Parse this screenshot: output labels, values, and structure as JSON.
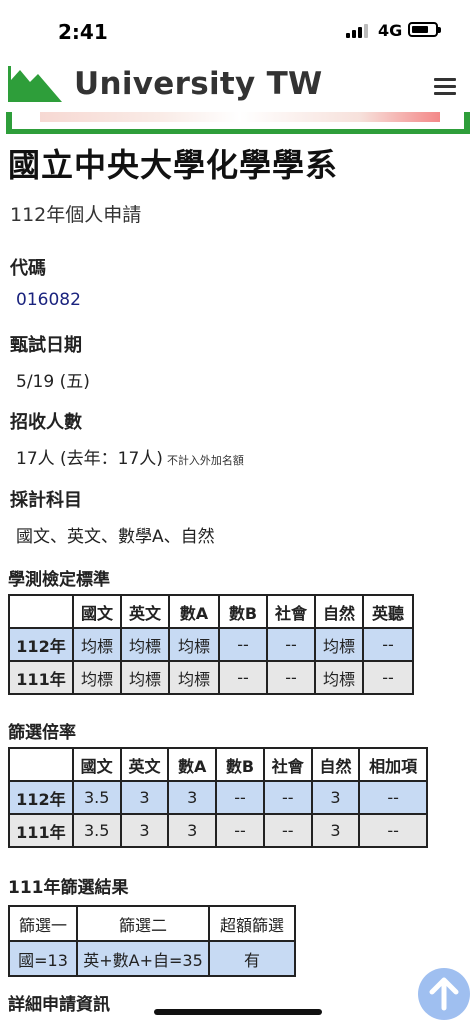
{
  "status_bar": {
    "time": "2:41",
    "network": "4G"
  },
  "header": {
    "brand": "University TW",
    "logo_icon": "mountain-logo-icon",
    "menu_icon": "hamburger-menu-icon"
  },
  "page": {
    "title": "國立中央大學化學學系",
    "subtitle": "112年個人申請"
  },
  "info": {
    "code_label": "代碼",
    "code_value": "016082",
    "exam_date_label": "甄試日期",
    "exam_date_value": "5/19 (五)",
    "enrollment_label": "招收人數",
    "enrollment_value": "17人 (去年：17人)",
    "enrollment_note": "不計入外加名額",
    "subjects_label": "採計科目",
    "subjects_value": "國文、英文、數學A、自然"
  },
  "standards": {
    "label": "學測檢定標準",
    "headers": [
      "國文",
      "英文",
      "數A",
      "數B",
      "社會",
      "自然",
      "英聽"
    ],
    "rows": [
      {
        "year": "112年",
        "cells": [
          "均標",
          "均標",
          "均標",
          "--",
          "--",
          "均標",
          "--"
        ]
      },
      {
        "year": "111年",
        "cells": [
          "均標",
          "均標",
          "均標",
          "--",
          "--",
          "均標",
          "--"
        ]
      }
    ]
  },
  "ratios": {
    "label": "篩選倍率",
    "headers": [
      "國文",
      "英文",
      "數A",
      "數B",
      "社會",
      "自然",
      "相加項"
    ],
    "rows": [
      {
        "year": "112年",
        "cells": [
          "3.5",
          "3",
          "3",
          "--",
          "--",
          "3",
          "--"
        ]
      },
      {
        "year": "111年",
        "cells": [
          "3.5",
          "3",
          "3",
          "--",
          "--",
          "3",
          "--"
        ]
      }
    ]
  },
  "results": {
    "label": "111年篩選結果",
    "headers": [
      "篩選一",
      "篩選二",
      "超額篩選"
    ],
    "values": [
      "國=13",
      "英+數A+自=35",
      "有"
    ]
  },
  "footer": {
    "detail_label": "詳細申請資訊",
    "scroll_icon": "arrow-up-icon"
  },
  "colors": {
    "brand_green": "#2e9e3a",
    "row_112": "#c7daf3",
    "row_111": "#e7e7e7",
    "link": "#1a237e"
  }
}
